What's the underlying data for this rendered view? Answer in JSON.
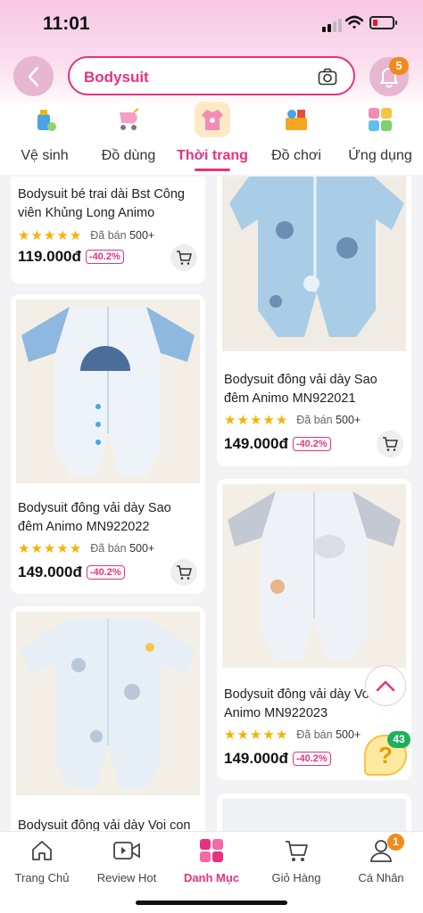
{
  "status_bar": {
    "time": "11:01"
  },
  "header": {
    "search_value": "Bodysuit",
    "notification_count": "5"
  },
  "categories": [
    {
      "label": "Vệ sinh",
      "icon": "cleaning-icon"
    },
    {
      "label": "Đồ dùng",
      "icon": "stroller-icon"
    },
    {
      "label": "Thời trang",
      "icon": "clothing-icon",
      "active": true
    },
    {
      "label": "Đồ chơi",
      "icon": "toys-icon"
    },
    {
      "label": "Ứng dụng",
      "icon": "apps-icon"
    }
  ],
  "products": [
    {
      "title": "Bodysuit bé trai dài Bst Công viên Khủng Long Animo",
      "sold_label": "Đã bán",
      "sold": "500+",
      "price": "119.000đ",
      "discount": "-40.2%",
      "rating": 5
    },
    {
      "title": "Bodysuit đông vải dày Sao đêm Animo MN922021",
      "sold_label": "Đã bán",
      "sold": "500+",
      "price": "149.000đ",
      "discount": "-40.2%",
      "rating": 5
    },
    {
      "title": "Bodysuit đông vải dày Sao đêm Animo MN922022",
      "sold_label": "Đã bán",
      "sold": "500+",
      "price": "149.000đ",
      "discount": "-40.2%",
      "rating": 5
    },
    {
      "title": "Bodysuit đông vải dày Voi Animo MN922023",
      "sold_label": "Đã bán",
      "sold": "500+",
      "price": "149.000đ",
      "discount": "-40.2%",
      "rating": 5
    },
    {
      "title": "Bodysuit đông vải dày Voi con"
    }
  ],
  "floating": {
    "help_count": "43"
  },
  "bottom_nav": [
    {
      "label": "Trang Chủ",
      "icon": "home-icon"
    },
    {
      "label": "Review Hot",
      "icon": "video-icon"
    },
    {
      "label": "Danh Mục",
      "icon": "category-icon",
      "active": true
    },
    {
      "label": "Giỏ Hàng",
      "icon": "cart-icon"
    },
    {
      "label": "Cá Nhân",
      "icon": "profile-icon",
      "badge": "1"
    }
  ],
  "colors": {
    "accent": "#e8317f",
    "star": "#f5b301",
    "badge_orange": "#f28a1b",
    "badge_green": "#1faf5c"
  }
}
